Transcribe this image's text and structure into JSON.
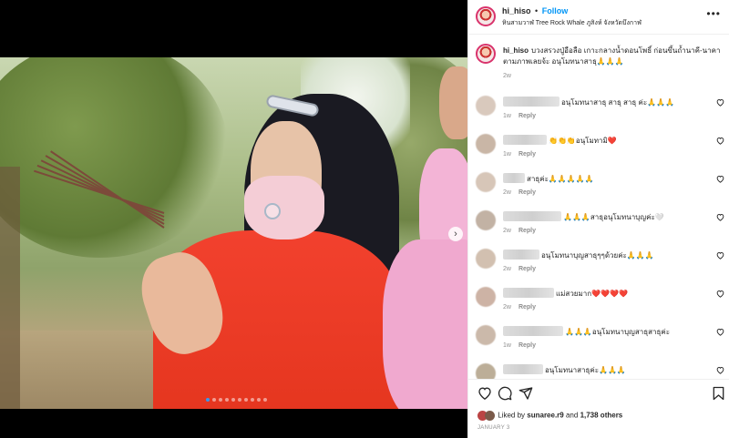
{
  "post": {
    "username": "hi_hiso",
    "separator": "•",
    "follow_label": "Follow",
    "location": "หินสามวาฬ Tree Rock Whale ภูสิงห์ จังหวัดบึงกาฬ",
    "more_icon": "more-horizontal-icon"
  },
  "caption": {
    "username": "hi_hiso",
    "text": "บวงสรวงปู่อือลือ เกาะกลางน้ำดอนโพธิ์ ก่อนขึ้นถ้ำนาคี-นาคา ตามภาพเลยจ้ะ อนุโมทนาสาธุ🙏🙏🙏",
    "time": "2w"
  },
  "comments": [
    {
      "text": "อนุโมทนาสาธุ สาธุ สาธุ ค่ะ🙏🙏🙏",
      "time": "1w",
      "reply": "Reply"
    },
    {
      "text": "👏👏👏อนุโมทามิ❤️",
      "time": "1w",
      "reply": "Reply"
    },
    {
      "text": "สาธุค่ะ🙏🙏🙏🙏🙏",
      "time": "2w",
      "reply": "Reply"
    },
    {
      "text": "🙏🙏🙏สาธุอนุโมทนาบุญค่ะ🤍",
      "time": "2w",
      "reply": "Reply"
    },
    {
      "text": "อนุโมทนาบุญสาธุๆๆด้วยค่ะ🙏🙏🙏",
      "time": "2w",
      "reply": "Reply"
    },
    {
      "text": "แม่สวยมาก❤️❤️❤️❤️",
      "time": "2w",
      "reply": "Reply"
    },
    {
      "text": "🙏🙏🙏อนุโมทนาบุญสาธุสาธุค่ะ",
      "time": "1w",
      "reply": "Reply"
    },
    {
      "text": "อนุโมทนาสาธุค่ะ🙏🙏🙏",
      "time": "",
      "reply": ""
    }
  ],
  "actions": {
    "like_icon": "heart-icon",
    "comment_icon": "comment-icon",
    "share_icon": "share-icon",
    "save_icon": "bookmark-icon"
  },
  "likes": {
    "prefix": "Liked by",
    "user": "sunaree.r9",
    "connector": "and",
    "others": "1,738 others"
  },
  "date": "JANUARY 3",
  "carousel": {
    "count": 10,
    "active_index": 0
  }
}
